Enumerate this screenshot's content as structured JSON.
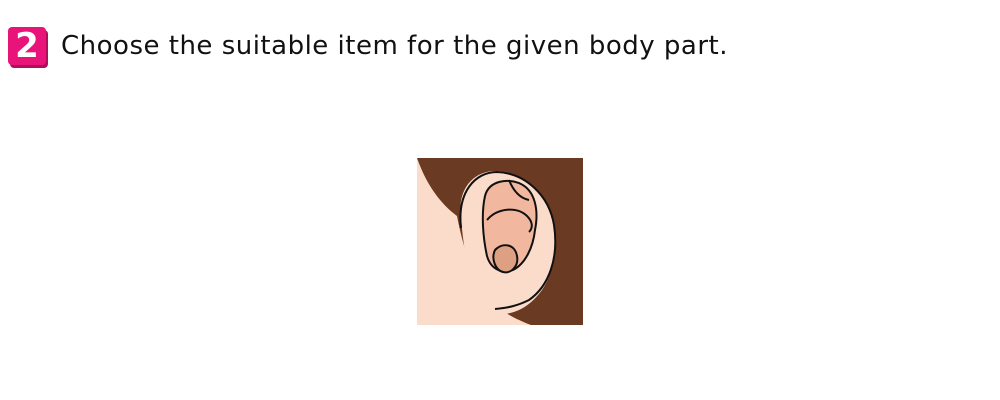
{
  "question": {
    "number": "2",
    "text": "Choose the suitable item for the given body part."
  },
  "image": {
    "subject": "ear-icon"
  },
  "colors": {
    "badge": "#e8147a",
    "hair": "#6b3a22",
    "skin": "#fbdccb",
    "ear_inner": "#f2b89f",
    "ear_deep": "#dea083",
    "outline": "#111111"
  }
}
